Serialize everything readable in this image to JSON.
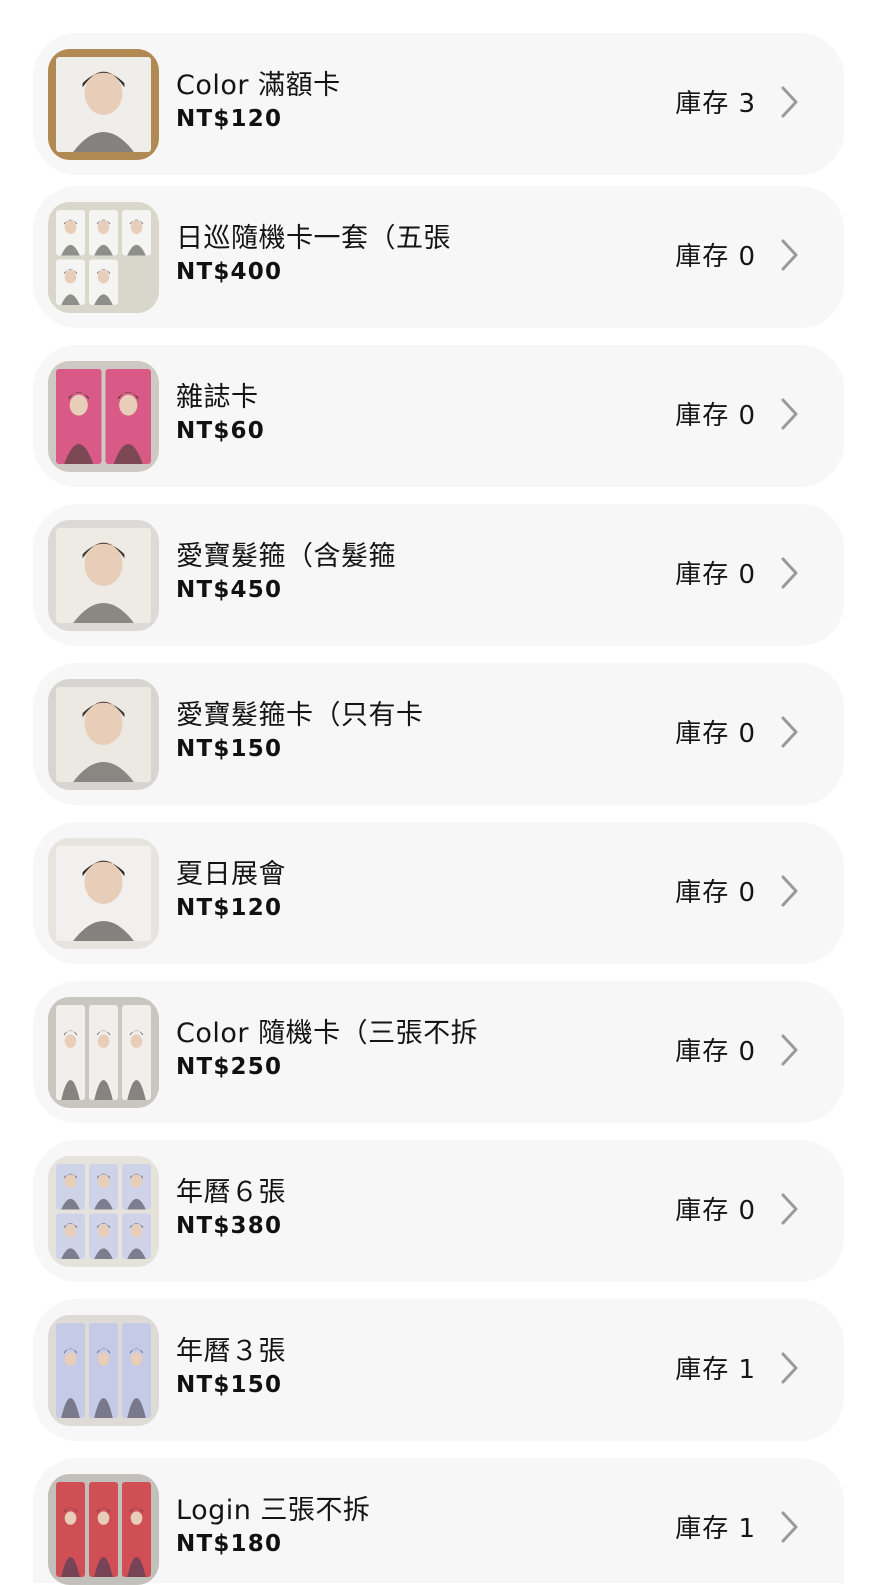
{
  "products": [
    {
      "name": "Color 滿額卡",
      "price": "NT$120",
      "stock": "庫存 3",
      "thumb": {
        "bg": "#b08a52",
        "card": "#f0eeea",
        "accent": "#2a2a2a",
        "count": 1
      }
    },
    {
      "name": "日巡隨機卡一套（五張",
      "price": "NT$400",
      "stock": "庫存 0",
      "thumb": {
        "bg": "#d9d6cc",
        "card": "#f4f4f2",
        "accent": "#3a3a3a",
        "count": 5
      }
    },
    {
      "name": "雜誌卡",
      "price": "NT$60",
      "stock": "庫存 0",
      "thumb": {
        "bg": "#cfc9c4",
        "card": "#d95a86",
        "accent": "#2d3a2a",
        "count": 2
      }
    },
    {
      "name": "愛寶髮箍（含髮箍",
      "price": "NT$450",
      "stock": "庫存 0",
      "thumb": {
        "bg": "#dcdad6",
        "card": "#eeeae4",
        "accent": "#3b3532",
        "count": 1
      }
    },
    {
      "name": "愛寶髮箍卡（只有卡",
      "price": "NT$150",
      "stock": "庫存 0",
      "thumb": {
        "bg": "#d7d5d1",
        "card": "#ece8e2",
        "accent": "#3b3532",
        "count": 1
      }
    },
    {
      "name": "夏日展會",
      "price": "NT$120",
      "stock": "庫存 0",
      "thumb": {
        "bg": "#e7e4df",
        "card": "#f1f0ee",
        "accent": "#2b2624",
        "count": 1
      }
    },
    {
      "name": "Color 隨機卡（三張不拆",
      "price": "NT$250",
      "stock": "庫存 0",
      "thumb": {
        "bg": "#c9c6c0",
        "card": "#f0efec",
        "accent": "#2d2b2a",
        "count": 3
      }
    },
    {
      "name": "年曆６張",
      "price": "NT$380",
      "stock": "庫存 0",
      "thumb": {
        "bg": "#e6e3dd",
        "card": "#cfd3ea",
        "accent": "#3a3740",
        "count": 6
      }
    },
    {
      "name": "年曆３張",
      "price": "NT$150",
      "stock": "庫存 1",
      "thumb": {
        "bg": "#dedbd6",
        "card": "#c5cbe6",
        "accent": "#3a3740",
        "count": 3
      }
    },
    {
      "name": "Login 三張不拆",
      "price": "NT$180",
      "stock": "庫存 1",
      "thumb": {
        "bg": "#c2c0ba",
        "card": "#cf4f55",
        "accent": "#2e3a5a",
        "count": 3
      }
    }
  ]
}
